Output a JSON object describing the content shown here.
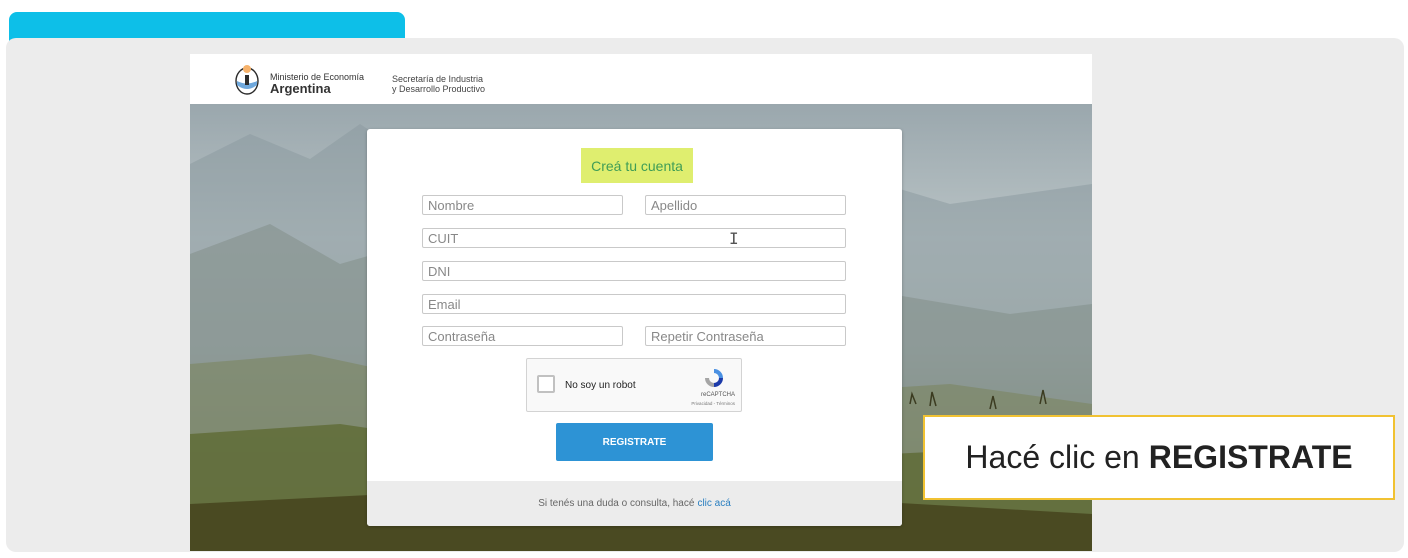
{
  "header": {
    "ministry_line1": "Ministerio de Economía",
    "ministry_line2": "Argentina",
    "secretaria_line1": "Secretaría de Industria",
    "secretaria_line2": "y Desarrollo Productivo"
  },
  "form": {
    "title": "Creá tu cuenta",
    "fields": {
      "nombre": "Nombre",
      "apellido": "Apellido",
      "cuit": "CUIT",
      "dni": "DNI",
      "email": "Email",
      "password": "Contraseña",
      "repeat_password": "Repetir Contraseña"
    },
    "recaptcha": {
      "label": "No soy un robot",
      "brand": "reCAPTCHA",
      "terms": "Privacidad - Términos"
    },
    "submit_label": "REGISTRATE",
    "footer_text": "Si tenés una duda o consulta, hacé",
    "footer_link": "clic acá"
  },
  "callout": {
    "prefix": "Hacé clic en",
    "emphasis": "REGISTRATE"
  },
  "colors": {
    "top_tab": "#0dbfe8",
    "title_highlight": "#dfee6f",
    "title_text": "#3f9d56",
    "button": "#2d93d5",
    "callout_border": "#f1c232",
    "link": "#2a7fc0"
  },
  "icons": [
    "argentina-seal-icon",
    "recaptcha-logo-icon",
    "text-cursor-icon"
  ]
}
